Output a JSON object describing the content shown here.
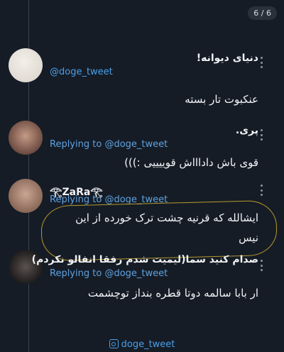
{
  "page_counter": "6 / 6",
  "tweets": [
    {
      "name": "دنیای دیوانه!",
      "handle": "@doge_tweet",
      "text": "عنکبوت تار بسته"
    },
    {
      "name": "پری.",
      "replying_label": "Replying to",
      "replying_handle": "@doge_tweet",
      "text": "قوی باش داداااش قوییییی :)))"
    },
    {
      "name": "𓂀ZaRa𓂀",
      "replying_label": "Replying to",
      "replying_handle": "@doge_tweet",
      "text_line1": "ایشالله که قرنیه چشت ترک خورده از این",
      "text_line2": "نیس"
    },
    {
      "name": "صدام کنید سما(لیمیت شدم رفقا انفالو نکردم)",
      "replying_label": "Replying to",
      "replying_handle": "@doge_tweet",
      "text": "ار بابا سالمه دوتا قطره بنداز توچشمت"
    }
  ],
  "footer": {
    "instagram_handle": "doge_tweet"
  },
  "colors": {
    "background": "#151c26",
    "link": "#4a9fe8",
    "highlight": "#b89a2e"
  }
}
